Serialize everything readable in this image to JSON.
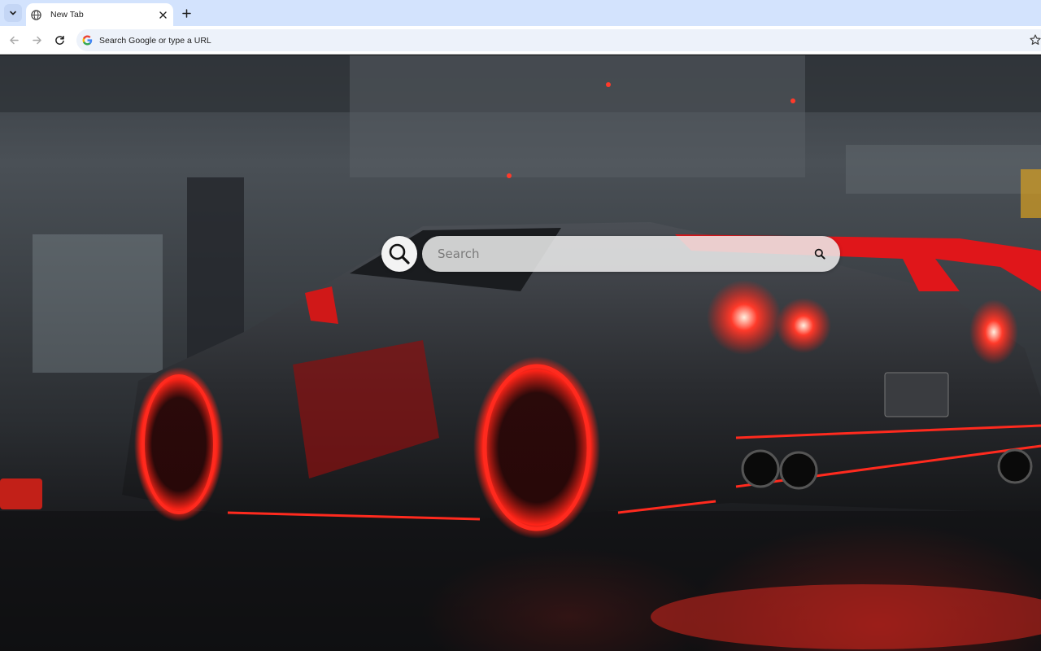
{
  "browser": {
    "tab": {
      "title": "New Tab"
    },
    "omnibox": {
      "placeholder": "Search Google or type a URL"
    }
  },
  "icons": {
    "tab_search": "chevron-down-icon",
    "favicon": "globe-icon",
    "close": "close-icon",
    "new_tab": "plus-icon",
    "back": "arrow-left-icon",
    "forward": "arrow-right-icon",
    "reload": "reload-icon",
    "google": "google-g-icon",
    "bookmark": "star-icon",
    "search": "magnifier-icon"
  },
  "search": {
    "placeholder": "Search"
  },
  "colors": {
    "tabstrip": "#d3e3fd",
    "omnibox": "#edf2fa",
    "accent_red": "#ff2a1e"
  }
}
